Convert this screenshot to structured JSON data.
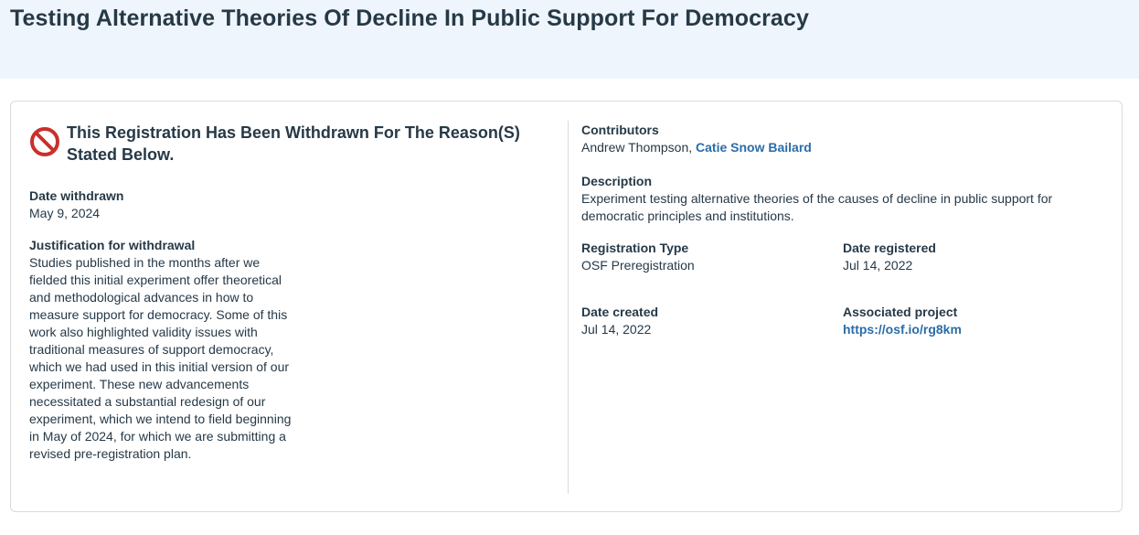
{
  "page": {
    "title": "Testing Alternative Theories Of Decline In Public Support For Democracy"
  },
  "withdrawal": {
    "banner_text": "This Registration Has Been Withdrawn For The Reason(S) Stated Below.",
    "icon": "prohibited-icon",
    "icon_color": "#c9302c",
    "date_label": "Date withdrawn",
    "date_value": "May 9, 2024",
    "justification_label": "Justification for withdrawal",
    "justification_text": "Studies published in the months after we fielded this initial experiment offer theoretical and methodological advances in how to measure support for democracy. Some of this work also highlighted validity issues with traditional measures of support democracy, which we had used in this initial version of our experiment. These new advancements necessitated a substantial redesign of our experiment, which we intend to field beginning in May of 2024, for which we are submitting a revised pre-registration plan."
  },
  "details": {
    "contributors_label": "Contributors",
    "contributors": [
      {
        "name": "Andrew Thompson",
        "linked": false
      },
      {
        "name": "Catie Snow Bailard",
        "linked": true
      }
    ],
    "contributors_separator": ", ",
    "description_label": "Description",
    "description_text": "Experiment testing alternative theories of the causes of decline in public support for democratic principles and institutions.",
    "registration_type_label": "Registration Type",
    "registration_type_value": "OSF Preregistration",
    "date_registered_label": "Date registered",
    "date_registered_value": "Jul 14, 2022",
    "date_created_label": "Date created",
    "date_created_value": "Jul 14, 2022",
    "associated_project_label": "Associated project",
    "associated_project_value": "https://osf.io/rg8km"
  },
  "colors": {
    "header_bg": "#eff5fc",
    "text": "#263947",
    "link": "#2a6ca8",
    "border": "#d8dbde"
  }
}
